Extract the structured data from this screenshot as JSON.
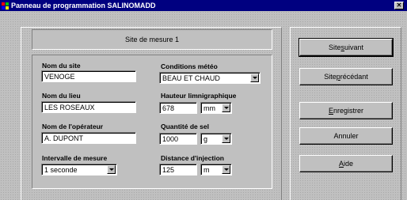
{
  "window": {
    "title": "Panneau de programmation SALINOMADD",
    "close_glyph": "✕"
  },
  "site_header": {
    "text": "Site de mesure 1"
  },
  "fields": {
    "site_name": {
      "label": "Nom du site",
      "value": "VENOGE"
    },
    "weather": {
      "label": "Conditions météo",
      "value": "BEAU ET CHAUD"
    },
    "place_name": {
      "label": "Nom du lieu",
      "value": "LES ROSEAUX"
    },
    "height": {
      "label": "Hauteur limnigraphique",
      "value": "678",
      "unit": "mm"
    },
    "operator": {
      "label": "Nom de l'opérateur",
      "value": "A. DUPONT"
    },
    "salt": {
      "label": "Quantité de sel",
      "value": "1000",
      "unit": "g"
    },
    "interval": {
      "label": "Intervalle de mesure",
      "value": "1 seconde"
    },
    "distance": {
      "label": "Distance d'injection",
      "value": "125",
      "unit": "m"
    }
  },
  "buttons": {
    "next": {
      "pre": "Site ",
      "accel": "s",
      "post": "uivant"
    },
    "prev": {
      "pre": "Site ",
      "accel": "p",
      "post": "récédant"
    },
    "save": {
      "pre": "",
      "accel": "E",
      "post": "nregistrer"
    },
    "cancel": {
      "label": "Annuler"
    },
    "help": {
      "pre": "",
      "accel": "A",
      "post": "ide"
    }
  },
  "colors": {
    "titlebar": "#000080",
    "face": "#c0c0c0"
  },
  "icons": {
    "app": "app-icon",
    "close": "close-icon",
    "dropdown": "chevron-down-icon"
  }
}
